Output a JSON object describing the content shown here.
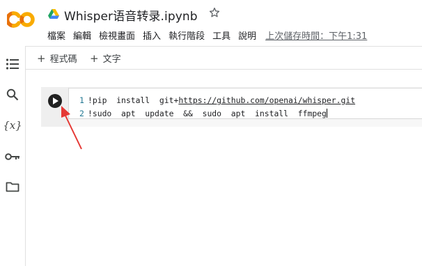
{
  "notebook": {
    "title": "Whisper语音转录.ipynb"
  },
  "menu": {
    "items": [
      "檔案",
      "編輯",
      "檢視畫面",
      "插入",
      "執行階段",
      "工具",
      "說明"
    ],
    "last_saved": "上次儲存時間：下午1:31"
  },
  "toolbar": {
    "add_code_label": "程式碼",
    "add_text_label": "文字"
  },
  "cell": {
    "line_numbers": [
      "1",
      "2"
    ],
    "line1_prefix": "!pip  install  git+",
    "line1_url": "https://github.com/openai/whisper.git",
    "line2": "!sudo  apt  update  &&  sudo  apt  install  ffmpeg"
  },
  "colors": {
    "logo_orange": "#F9AB00",
    "logo_dark_orange": "#E8710A",
    "annotation_arrow": "#E53935",
    "run_button": "#212121"
  },
  "icons": {
    "rail": [
      "table-of-contents-icon",
      "search-icon",
      "variables-icon",
      "secrets-key-icon",
      "files-folder-icon"
    ]
  }
}
